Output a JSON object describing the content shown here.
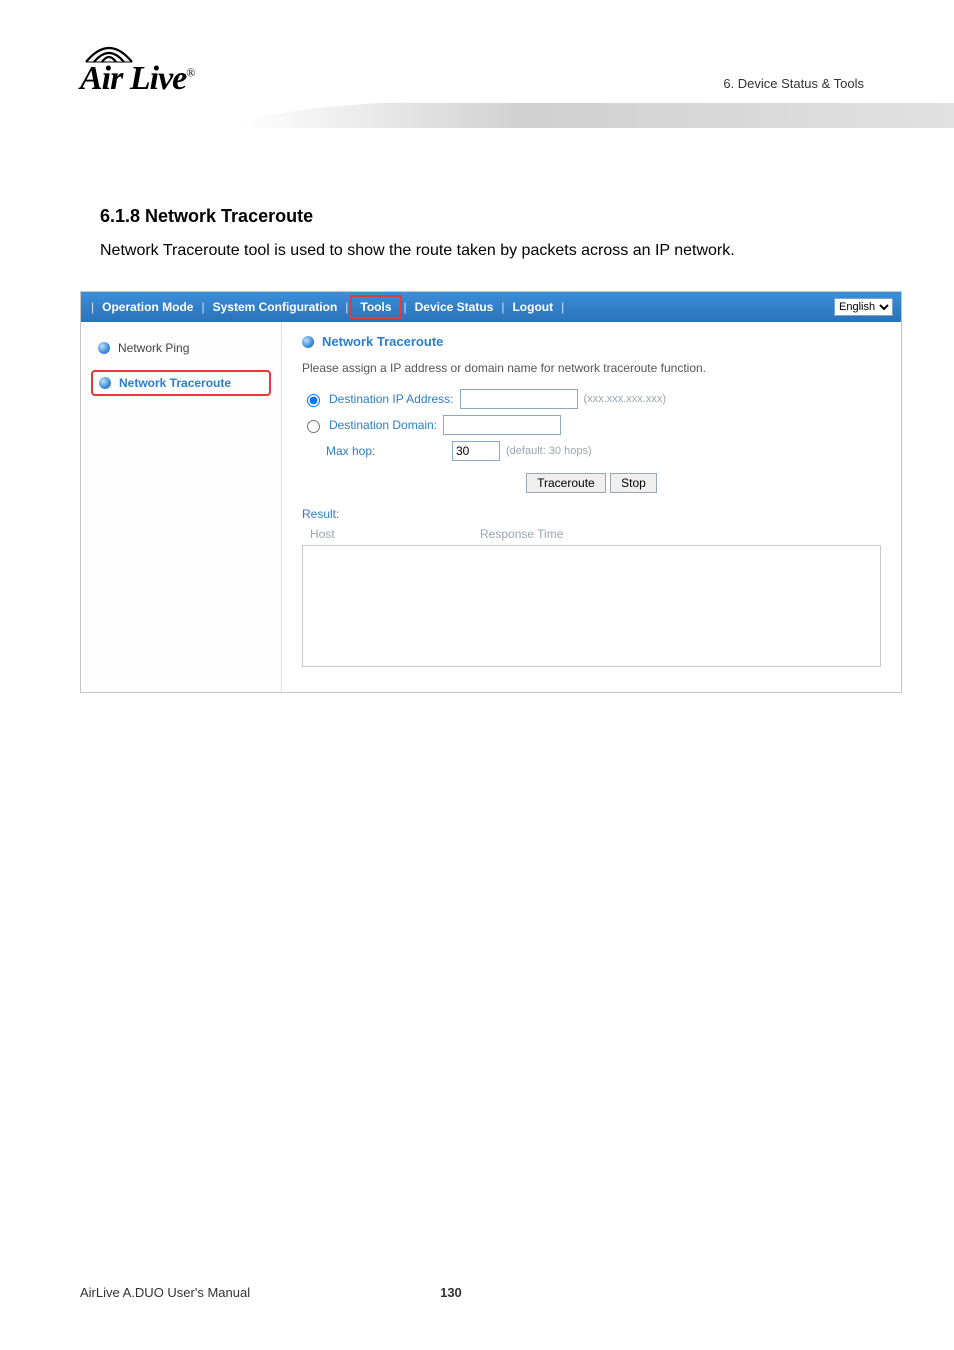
{
  "header": {
    "logo_text": "Air Live",
    "reg": "®",
    "chapter": "6.  Device  Status  &  Tools"
  },
  "section": {
    "heading": "6.1.8 Network Traceroute",
    "paragraph": "Network Traceroute tool is used to show the route taken by packets across an IP network."
  },
  "app": {
    "tabs": {
      "operation_mode": "Operation Mode",
      "system_configuration": "System Configuration",
      "tools": "Tools",
      "device_status": "Device Status",
      "logout": "Logout"
    },
    "language": {
      "selected": "English"
    },
    "sidebar": {
      "items": [
        {
          "label": "Network Ping"
        },
        {
          "label": "Network Traceroute"
        }
      ]
    },
    "panel": {
      "title": "Network Traceroute",
      "description": "Please assign a IP address or domain name for network traceroute function.",
      "dest_ip_label": "Destination IP Address:",
      "dest_ip_value": "",
      "dest_ip_hint": "(xxx.xxx.xxx.xxx)",
      "dest_domain_label": "Destination Domain:",
      "dest_domain_value": "",
      "maxhop_label": "Max hop:",
      "maxhop_value": "30",
      "maxhop_hint": "(default: 30 hops)",
      "traceroute_btn": "Traceroute",
      "stop_btn": "Stop",
      "result_label": "Result:",
      "col_host": "Host",
      "col_resp": "Response Time"
    }
  },
  "footer": {
    "manual": "AirLive A.DUO User's Manual",
    "page": "130"
  }
}
